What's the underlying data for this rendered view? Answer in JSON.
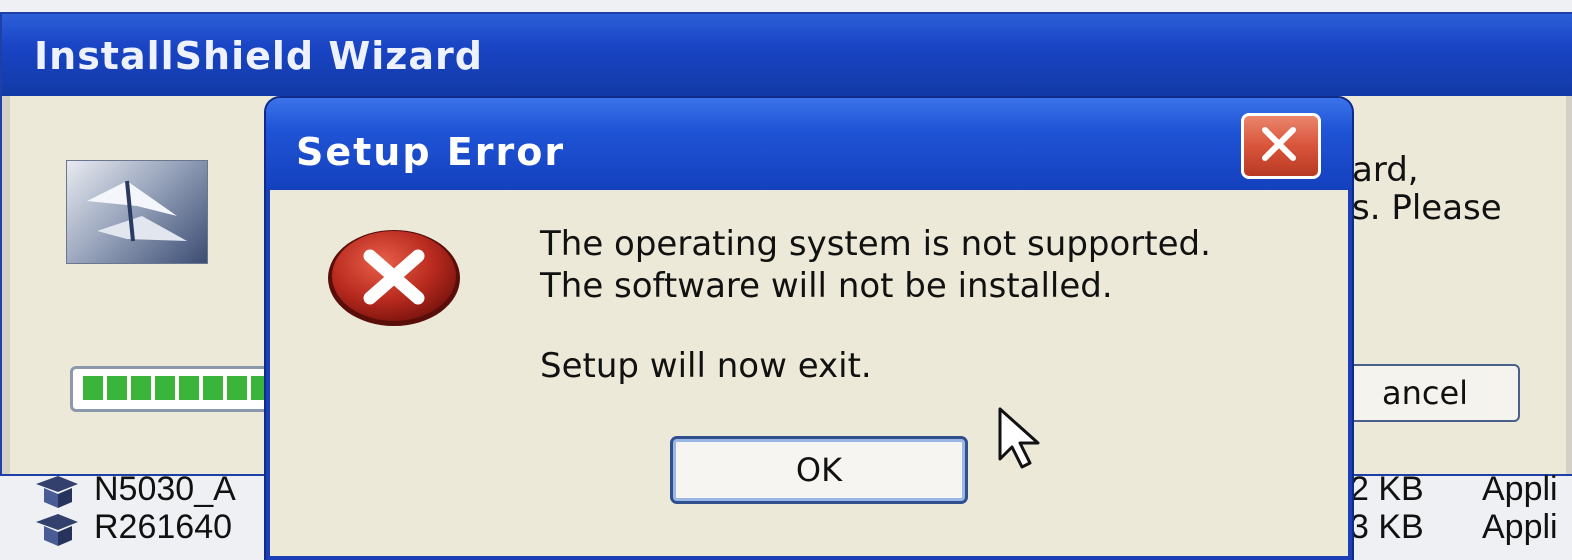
{
  "background_window": {
    "title": "InstallShield Wizard",
    "partial_text_line1": "ard,",
    "partial_text_line2": "s. Please",
    "cancel_label": "ancel"
  },
  "file_list": [
    {
      "name": "N5030_A",
      "size": "2 KB",
      "type": "Appli"
    },
    {
      "name": "R261640",
      "size": "3 KB",
      "type": "Appli"
    }
  ],
  "dialog": {
    "title": "Setup Error",
    "message_line1": "The operating system is not supported.",
    "message_line2": "The software will not be installed.",
    "message_line3": "Setup will now exit.",
    "ok_label": "OK",
    "icon": "error-icon"
  },
  "colors": {
    "titlebar_blue": "#1f54d6",
    "dialog_bg": "#ece9d8",
    "error_red": "#b82a1e",
    "close_red": "#d9543a",
    "progress_green": "#3bb43b"
  }
}
